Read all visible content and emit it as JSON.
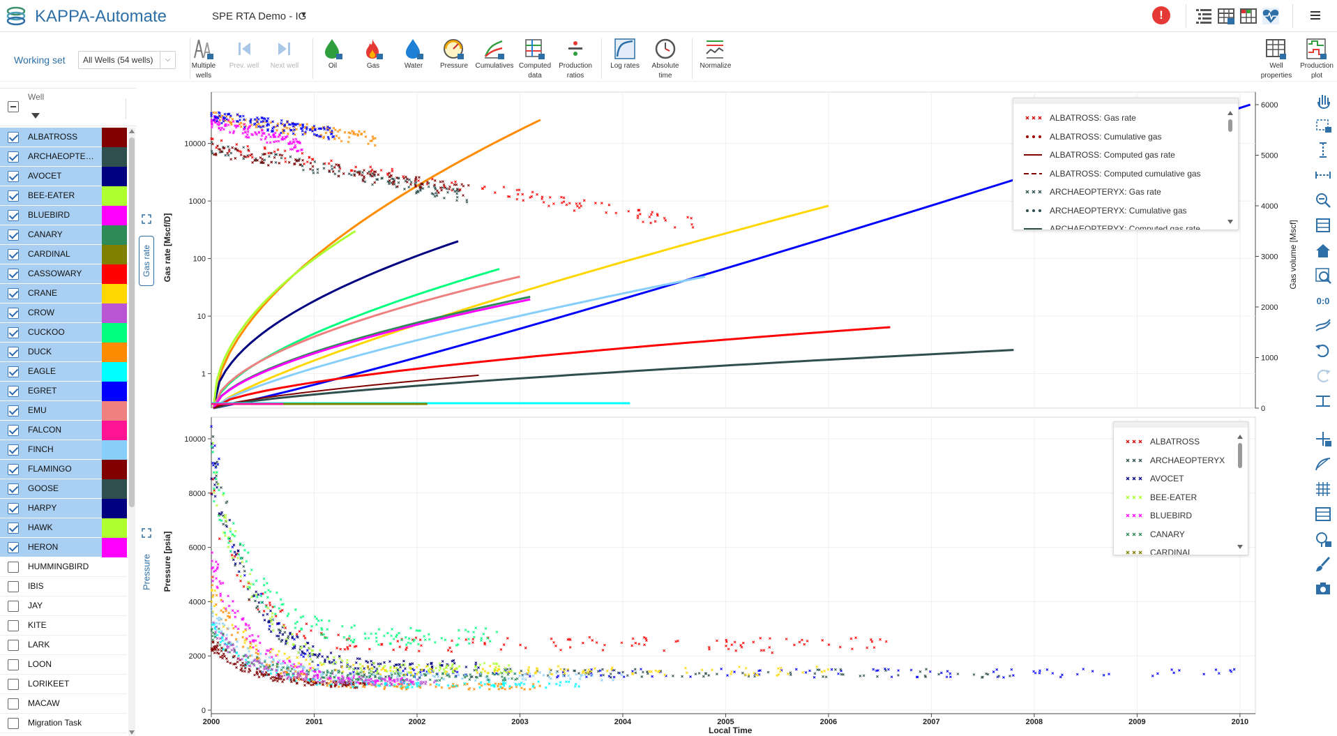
{
  "header": {
    "app_title": "KAPPA-Automate",
    "project_name": "SPE RTA Demo - IG",
    "alert_symbol": "!",
    "icons": [
      "list-tree-icon",
      "table-grid-icon",
      "colored-grid-icon",
      "heart-monitor-icon"
    ],
    "menu_icon": "hamburger-menu-icon"
  },
  "toolbar": {
    "working_set_label": "Working set",
    "working_set_value": "All Wells (54 wells)",
    "buttons": [
      {
        "label1": "Multiple",
        "label2": "wells",
        "icon": "multiple-wells-icon",
        "enabled": true
      },
      {
        "label1": "Prev. well",
        "label2": "",
        "icon": "prev-well-icon",
        "enabled": false
      },
      {
        "label1": "Next well",
        "label2": "",
        "icon": "next-well-icon",
        "enabled": false
      },
      {
        "label1": "Oil",
        "label2": "",
        "icon": "oil-drop-icon",
        "enabled": true
      },
      {
        "label1": "Gas",
        "label2": "",
        "icon": "gas-flame-icon",
        "enabled": true
      },
      {
        "label1": "Water",
        "label2": "",
        "icon": "water-drop-icon",
        "enabled": true
      },
      {
        "label1": "Pressure",
        "label2": "",
        "icon": "pressure-gauge-icon",
        "enabled": true
      },
      {
        "label1": "Cumulatives",
        "label2": "",
        "icon": "cumulatives-icon",
        "enabled": true
      },
      {
        "label1": "Computed",
        "label2": "data",
        "icon": "computed-data-icon",
        "enabled": true
      },
      {
        "label1": "Production",
        "label2": "ratios",
        "icon": "production-ratios-icon",
        "enabled": true
      },
      {
        "label1": "Log rates",
        "label2": "",
        "icon": "log-rates-icon",
        "enabled": true
      },
      {
        "label1": "Absolute",
        "label2": "time",
        "icon": "absolute-time-icon",
        "enabled": true
      },
      {
        "label1": "Normalize",
        "label2": "",
        "icon": "normalize-icon",
        "enabled": true
      },
      {
        "label1": "Well",
        "label2": "properties",
        "icon": "well-properties-icon",
        "enabled": true
      },
      {
        "label1": "Production",
        "label2": "plot",
        "icon": "production-plot-icon",
        "enabled": true
      }
    ]
  },
  "well_list": {
    "column_label": "Well",
    "wells": [
      {
        "name": "ALBATROSS",
        "checked": true,
        "color": "#800000"
      },
      {
        "name": "ARCHAEOPTERYX",
        "checked": true,
        "color": "#2f4f4f"
      },
      {
        "name": "AVOCET",
        "checked": true,
        "color": "#000080"
      },
      {
        "name": "BEE-EATER",
        "checked": true,
        "color": "#adff2f"
      },
      {
        "name": "BLUEBIRD",
        "checked": true,
        "color": "#ff00ff"
      },
      {
        "name": "CANARY",
        "checked": true,
        "color": "#2e8b57"
      },
      {
        "name": "CARDINAL",
        "checked": true,
        "color": "#808000"
      },
      {
        "name": "CASSOWARY",
        "checked": true,
        "color": "#ff0000"
      },
      {
        "name": "CRANE",
        "checked": true,
        "color": "#ffd700"
      },
      {
        "name": "CROW",
        "checked": true,
        "color": "#ba55d3"
      },
      {
        "name": "CUCKOO",
        "checked": true,
        "color": "#00ff7f"
      },
      {
        "name": "DUCK",
        "checked": true,
        "color": "#ff8c00"
      },
      {
        "name": "EAGLE",
        "checked": true,
        "color": "#00ffff"
      },
      {
        "name": "EGRET",
        "checked": true,
        "color": "#0000ff"
      },
      {
        "name": "EMU",
        "checked": true,
        "color": "#f08080"
      },
      {
        "name": "FALCON",
        "checked": true,
        "color": "#ff1493"
      },
      {
        "name": "FINCH",
        "checked": true,
        "color": "#87cefa"
      },
      {
        "name": "FLAMINGO",
        "checked": true,
        "color": "#800000"
      },
      {
        "name": "GOOSE",
        "checked": true,
        "color": "#2f4f4f"
      },
      {
        "name": "HARPY",
        "checked": true,
        "color": "#000080"
      },
      {
        "name": "HAWK",
        "checked": true,
        "color": "#adff2f"
      },
      {
        "name": "HERON",
        "checked": true,
        "color": "#ff00ff"
      },
      {
        "name": "HUMMINGBIRD",
        "checked": false,
        "color": ""
      },
      {
        "name": "IBIS",
        "checked": false,
        "color": ""
      },
      {
        "name": "JAY",
        "checked": false,
        "color": ""
      },
      {
        "name": "KITE",
        "checked": false,
        "color": ""
      },
      {
        "name": "LARK",
        "checked": false,
        "color": ""
      },
      {
        "name": "LOON",
        "checked": false,
        "color": ""
      },
      {
        "name": "LORIKEET",
        "checked": false,
        "color": ""
      },
      {
        "name": "MACAW",
        "checked": false,
        "color": ""
      },
      {
        "name": "Migration Task",
        "checked": false,
        "color": ""
      }
    ]
  },
  "plots": {
    "gas_tab_label": "Gas rate",
    "pressure_tab_label": "Pressure",
    "x_axis_title": "Local Time",
    "x_ticks": [
      "2000",
      "2001",
      "2002",
      "2003",
      "2004",
      "2005",
      "2006",
      "2007",
      "2008",
      "2009",
      "2010"
    ],
    "top": {
      "y_left_title": "Gas rate [Mscf/D]",
      "y_right_title": "Gas volume [Mscf]",
      "y_left_ticks": [
        "1",
        "10",
        "100",
        "1000",
        "10000"
      ],
      "y_right_ticks": [
        "0",
        "1000",
        "2000",
        "3000",
        "4000",
        "5000",
        "6000"
      ],
      "legend": [
        {
          "label": "ALBATROSS: Gas rate",
          "style": "x",
          "color": "#d40000"
        },
        {
          "label": "ALBATROSS: Cumulative gas",
          "style": "dot",
          "color": "#a00000"
        },
        {
          "label": "ALBATROSS: Computed gas rate",
          "style": "line",
          "color": "#800000"
        },
        {
          "label": "ALBATROSS: Computed cumulative gas",
          "style": "dash",
          "color": "#800000"
        },
        {
          "label": "ARCHAEOPTERYX: Gas rate",
          "style": "x",
          "color": "#2f4f4f"
        },
        {
          "label": "ARCHAEOPTERYX: Cumulative gas",
          "style": "dot",
          "color": "#2f4f4f"
        },
        {
          "label": "ARCHAEOPTERYX: Computed gas rate",
          "style": "line",
          "color": "#2f4f4f"
        }
      ]
    },
    "bottom": {
      "y_left_title": "Pressure [psia]",
      "y_left_ticks": [
        "0",
        "2000",
        "4000",
        "6000",
        "8000",
        "10000"
      ],
      "legend": [
        {
          "label": "ALBATROSS",
          "style": "x",
          "color": "#d40000"
        },
        {
          "label": "ARCHAEOPTERYX",
          "style": "x",
          "color": "#2f4f4f"
        },
        {
          "label": "AVOCET",
          "style": "x",
          "color": "#000080"
        },
        {
          "label": "BEE-EATER",
          "style": "x",
          "color": "#adff2f"
        },
        {
          "label": "BLUEBIRD",
          "style": "x",
          "color": "#ff00ff"
        },
        {
          "label": "CANARY",
          "style": "x",
          "color": "#2e8b57"
        },
        {
          "label": "CARDINAL",
          "style": "x",
          "color": "#808000"
        }
      ]
    }
  },
  "right_tools": [
    "pan-hand-icon",
    "box-zoom-icon",
    "vertical-zoom-icon",
    "horizontal-zoom-icon",
    "zoom-out-icon",
    "fit-all-icon",
    "home-icon",
    "zoom-area-icon",
    "zero-icon",
    "curves-icon",
    "undo-icon",
    "redo-icon",
    "align-icon",
    "crosshair-icon",
    "slope-icon",
    "grid-icon",
    "table-view-icon",
    "annotation-icon",
    "brush-icon",
    "camera-icon"
  ]
}
